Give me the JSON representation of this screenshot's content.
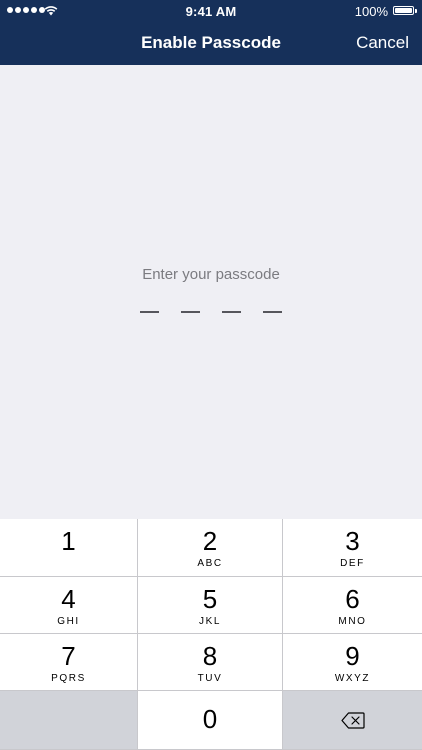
{
  "status_bar": {
    "time": "9:41 AM",
    "battery_percent": "100%",
    "signal_strength": 5
  },
  "nav": {
    "title": "Enable Passcode",
    "cancel_label": "Cancel"
  },
  "passcode": {
    "prompt": "Enter your passcode",
    "digits_total": 4,
    "digits_entered": 0
  },
  "keypad": {
    "keys": [
      {
        "number": "1",
        "letters": ""
      },
      {
        "number": "2",
        "letters": "ABC"
      },
      {
        "number": "3",
        "letters": "DEF"
      },
      {
        "number": "4",
        "letters": "GHI"
      },
      {
        "number": "5",
        "letters": "JKL"
      },
      {
        "number": "6",
        "letters": "MNO"
      },
      {
        "number": "7",
        "letters": "PQRS"
      },
      {
        "number": "8",
        "letters": "TUV"
      },
      {
        "number": "9",
        "letters": "WXYZ"
      },
      {
        "number": "0",
        "letters": ""
      }
    ]
  },
  "colors": {
    "header_bg": "#16305a",
    "screen_bg": "#efeff4",
    "key_bg": "#ffffff",
    "key_dark_bg": "#d1d3d9"
  },
  "icons": [
    "wifi-icon",
    "battery-icon",
    "backspace-icon"
  ]
}
